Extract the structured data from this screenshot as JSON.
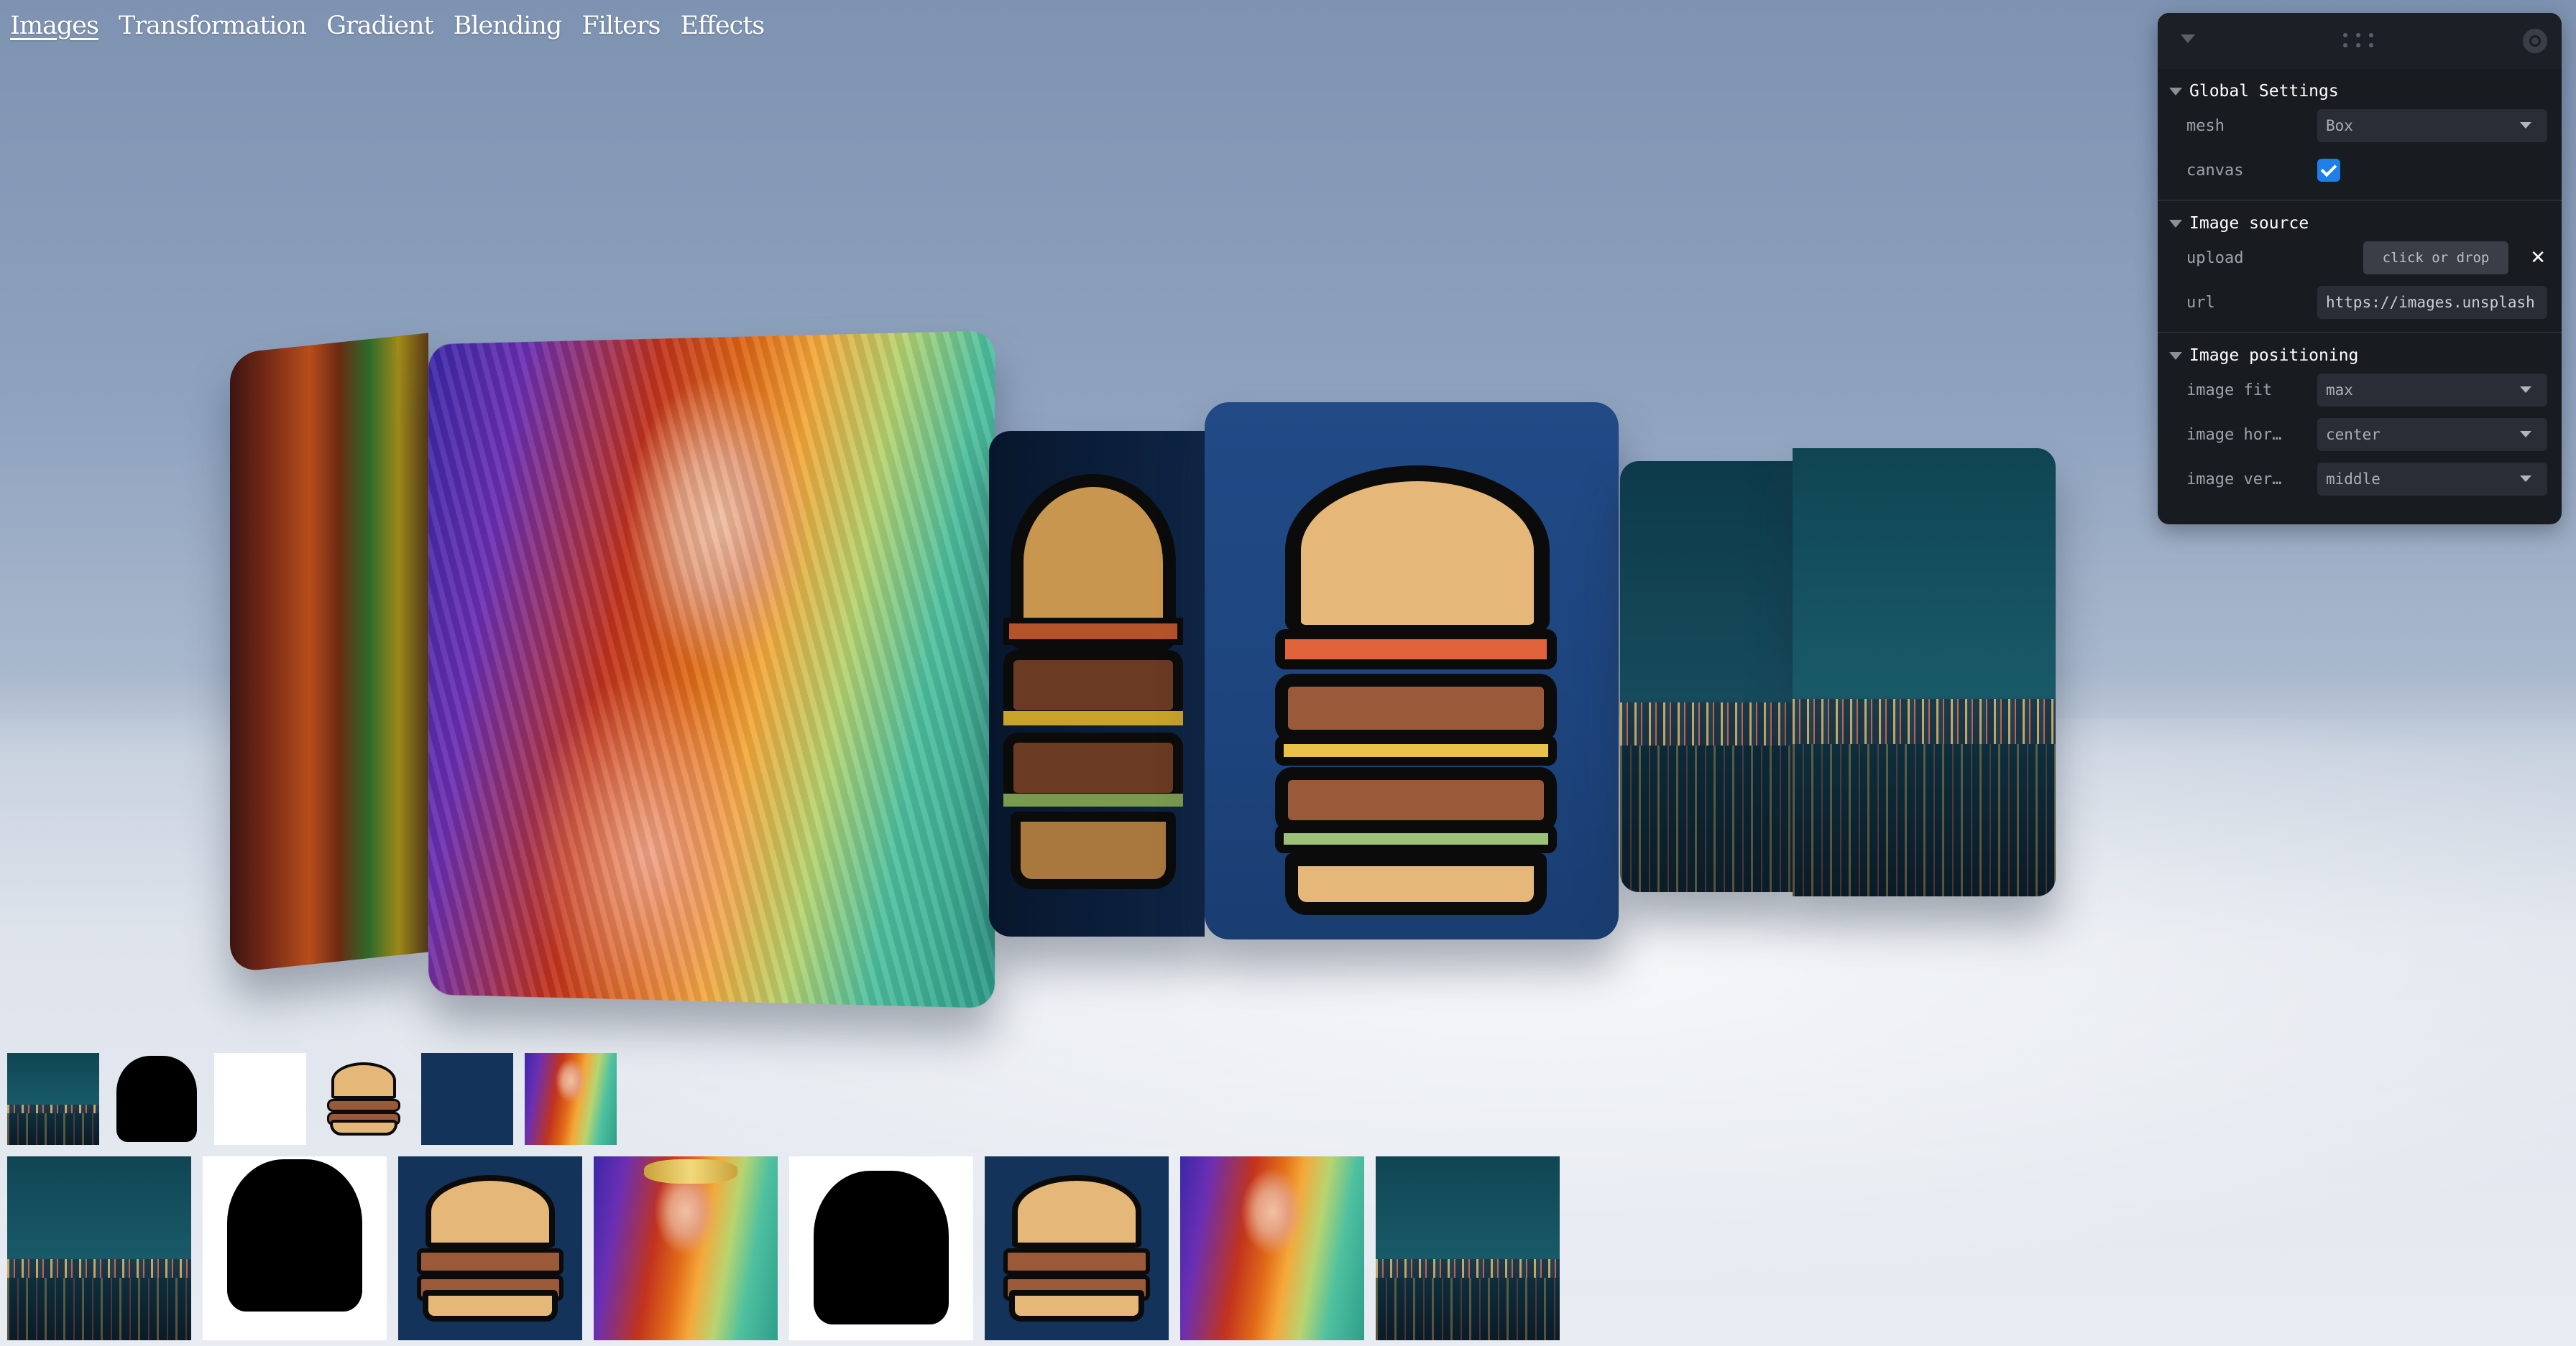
{
  "nav": {
    "items": [
      "Images",
      "Transformation",
      "Gradient",
      "Blending",
      "Filters",
      "Effects"
    ]
  },
  "panel": {
    "sections": {
      "global": {
        "title": "Global Settings",
        "mesh_label": "mesh",
        "mesh_value": "Box",
        "canvas_label": "canvas",
        "canvas_checked": true
      },
      "source": {
        "title": "Image source",
        "upload_label": "upload",
        "upload_button": "click or drop",
        "url_label": "url",
        "url_value": "https://images.unsplash"
      },
      "positioning": {
        "title": "Image positioning",
        "fit_label": "image fit",
        "fit_value": "max",
        "hor_label": "image hor…",
        "hor_value": "center",
        "ver_label": "image ver…",
        "ver_value": "middle"
      }
    }
  },
  "colors": {
    "accent": "#1f7fe8",
    "panel_bg": "#181c20",
    "burger_bun": "#e5b879"
  },
  "thumbnails": {
    "small": [
      "city",
      "burger-mask",
      "white",
      "burger",
      "navy",
      "woman"
    ],
    "large": [
      "city",
      "burger-mask",
      "burger",
      "woman",
      "burger-mask",
      "burger",
      "woman",
      "city"
    ]
  }
}
